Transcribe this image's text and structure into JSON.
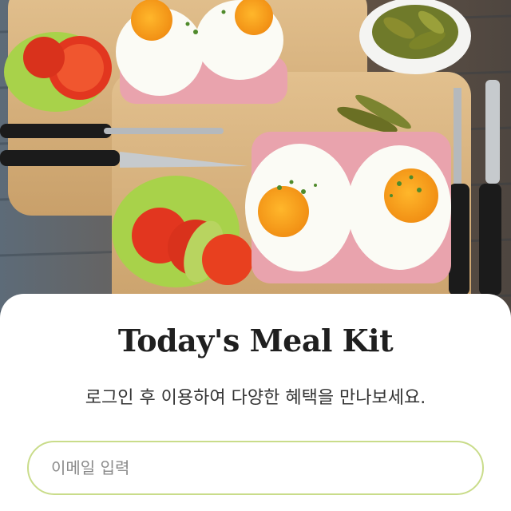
{
  "hero": {
    "image": "breakfast-sandwich-photo"
  },
  "login": {
    "title": "Today's Meal Kit",
    "subtitle": "로그인 후 이용하여 다양한 혜택을 만나보세요.",
    "email_placeholder": "이메일 입력",
    "email_value": ""
  },
  "colors": {
    "input_border": "#c9dc8a",
    "title_text": "#1f1f1f",
    "sheet_background": "#ffffff"
  }
}
